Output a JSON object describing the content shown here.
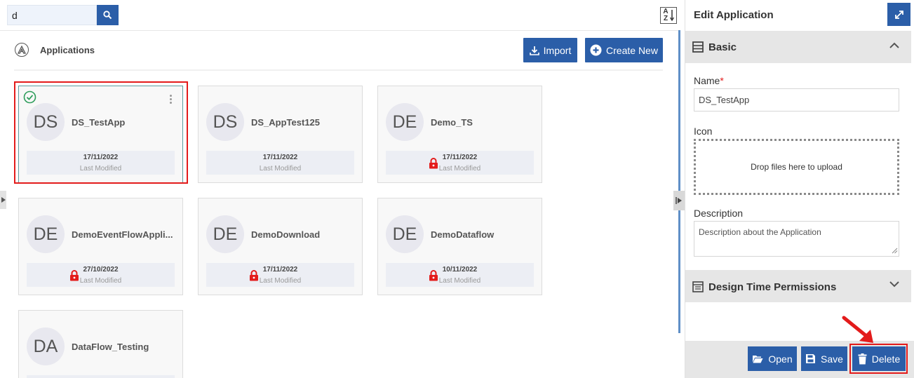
{
  "search": {
    "value": "d"
  },
  "sort_label_top": "A",
  "sort_label_bottom": "Z",
  "apps_header": {
    "title": "Applications"
  },
  "toolbar": {
    "import_label": "Import",
    "create_label": "Create New"
  },
  "cards": [
    {
      "initials": "DS",
      "name": "DS_TestApp",
      "date": "17/11/2022",
      "modified_label": "Last Modified",
      "locked": false,
      "selected": true
    },
    {
      "initials": "DS",
      "name": "DS_AppTest125",
      "date": "17/11/2022",
      "modified_label": "Last Modified",
      "locked": false,
      "selected": false
    },
    {
      "initials": "DE",
      "name": "Demo_TS",
      "date": "17/11/2022",
      "modified_label": "Last Modified",
      "locked": true,
      "selected": false
    },
    {
      "initials": "DE",
      "name": "DemoEventFlowAppli...",
      "date": "27/10/2022",
      "modified_label": "Last Modified",
      "locked": true,
      "selected": false
    },
    {
      "initials": "DE",
      "name": "DemoDownload",
      "date": "17/11/2022",
      "modified_label": "Last Modified",
      "locked": true,
      "selected": false
    },
    {
      "initials": "DE",
      "name": "DemoDataflow",
      "date": "10/11/2022",
      "modified_label": "Last Modified",
      "locked": true,
      "selected": false
    },
    {
      "initials": "DA",
      "name": "DataFlow_Testing",
      "date": "",
      "modified_label": "",
      "locked": false,
      "selected": false
    }
  ],
  "panel": {
    "title": "Edit Application",
    "basic_section": "Basic",
    "name_label": "Name",
    "required_mark": "*",
    "name_value": "DS_TestApp",
    "icon_label": "Icon",
    "dropzone_text": "Drop files here to upload",
    "description_label": "Description",
    "description_placeholder": "Description about the Application",
    "permissions_section": "Design Time Permissions",
    "open_label": "Open",
    "save_label": "Save",
    "delete_label": "Delete"
  },
  "colors": {
    "accent": "#2b5ea8",
    "highlight": "#e31b1b",
    "check": "#2e9d5b"
  }
}
